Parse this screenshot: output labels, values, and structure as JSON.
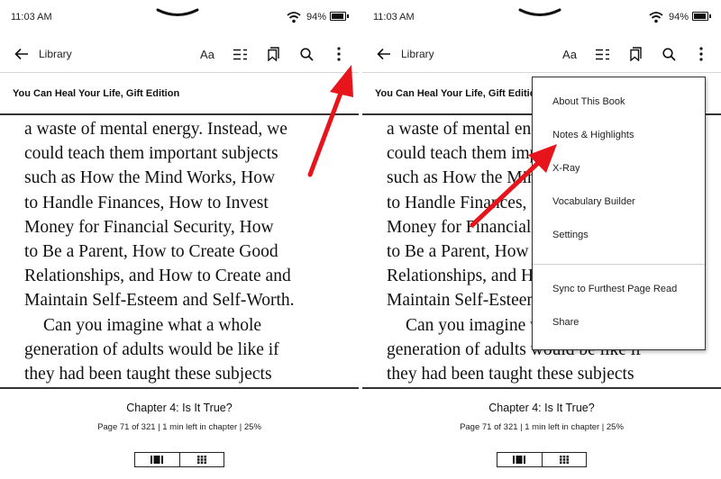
{
  "status": {
    "time": "11:03 AM",
    "battery": "94%",
    "battery_level": 0.94
  },
  "toolbar": {
    "back_label": "Library",
    "font_label": "Aa"
  },
  "book": {
    "title": "You Can Heal Your Life, Gift Edition"
  },
  "page_text": [
    "a waste of mental energy. Instead, we",
    "could teach them important subjects",
    "such as How the Mind Works, How",
    "to Handle Finances, How to Invest",
    "Money for Financial Security, How",
    "to Be a Parent, How to Create Good",
    "Relationships, and How to Create and",
    "Maintain Self-Esteem and Self-Worth.",
    "Can you imagine what a whole",
    "generation of adults would be like if",
    "they had been taught these subjects"
  ],
  "footer": {
    "chapter": "Chapter 4: Is It True?",
    "page_info": "Page 71 of 321 | 1 min left in chapter | 25%"
  },
  "menu": {
    "items": [
      "About This Book",
      "Notes & Highlights",
      "X-Ray",
      "Vocabulary Builder",
      "Settings",
      "Sync to Furthest Page Read",
      "Share"
    ]
  },
  "icons": [
    "back-arrow-icon",
    "table-of-contents-icon",
    "bookmarks-icon",
    "search-icon",
    "more-vertical-icon",
    "wifi-icon",
    "battery-icon",
    "page-view-icon",
    "grid-view-icon"
  ],
  "colors": {
    "annotation_arrow": "#e8141c",
    "text": "#111111"
  }
}
